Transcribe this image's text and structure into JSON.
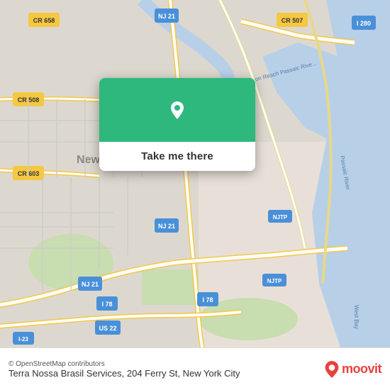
{
  "map": {
    "alt": "Map showing Newark, NJ area",
    "popup": {
      "button_label": "Take me there"
    }
  },
  "bottom_bar": {
    "attribution": "© OpenStreetMap contributors",
    "business_name": "Terra Nossa Brasil Services, 204 Ferry St, New York City"
  },
  "moovit": {
    "text": "moovit"
  },
  "icons": {
    "location_pin": "location-pin",
    "moovit_pin": "moovit-pin"
  },
  "colors": {
    "green": "#2eb87e",
    "red": "#e84040",
    "road_yellow": "#f5c842",
    "road_white": "#ffffff",
    "water": "#b8d4e8",
    "land": "#e8e0d8",
    "urban": "#d8d0c8"
  }
}
